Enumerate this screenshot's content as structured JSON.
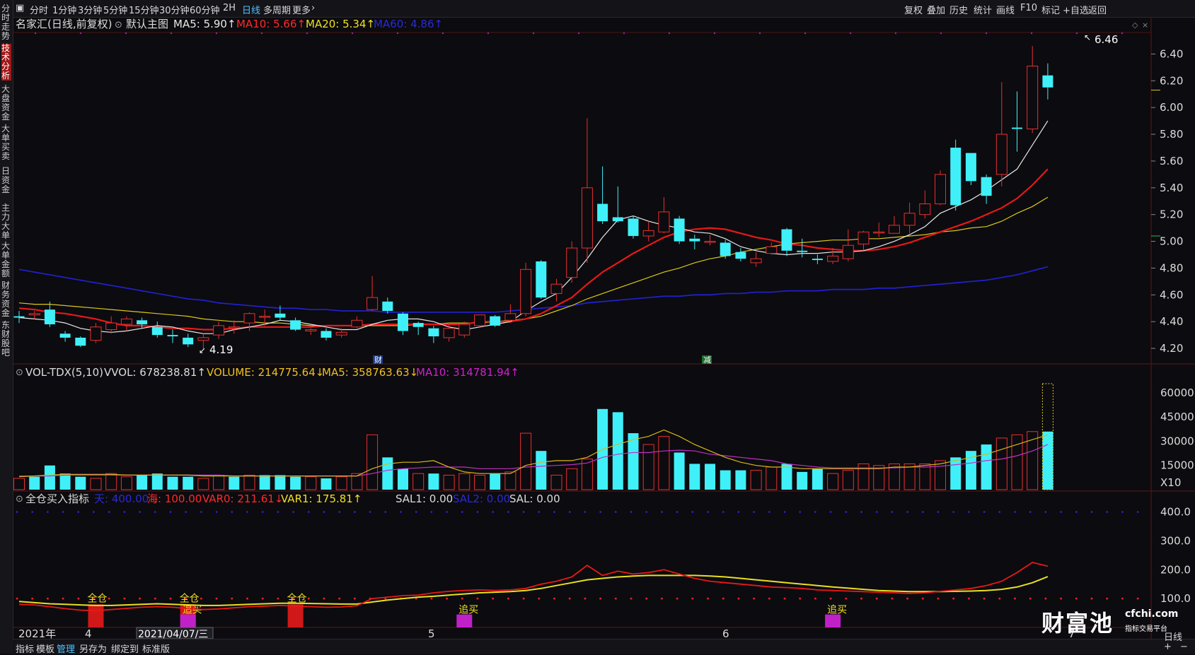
{
  "toolbar": {
    "items": [
      "分时",
      "1分钟",
      "3分钟",
      "5分钟",
      "15分钟",
      "30分钟",
      "60分钟",
      "2H",
      "日线",
      "多周期",
      "更多"
    ],
    "active_index": 8,
    "right_items": [
      "复权",
      "叠加",
      "历史",
      "统计",
      "画线",
      "F10",
      "标记",
      "+自选",
      "返回"
    ]
  },
  "sidebar": {
    "items": [
      "分时走势",
      "技术分析",
      "大盘资金",
      "大单买卖",
      "日资金",
      "主力大单",
      "大单金额",
      "财务资金",
      "东财股吧"
    ],
    "active_index": 1
  },
  "main_panel": {
    "title": "名家汇(日线,前复权)",
    "indicator": "默认主图",
    "ma5": "MA5: 5.90↑",
    "ma10": "MA10: 5.66↑",
    "ma20": "MA20: 5.34↑",
    "ma60": "MA60: 4.86↑",
    "high_label": "6.46",
    "low_label": "4.19",
    "marker_cai": "财",
    "marker_jian": "减",
    "y_ticks": [
      "6.40",
      "6.20",
      "6.00",
      "5.80",
      "5.60",
      "5.40",
      "5.20",
      "5.00",
      "4.80",
      "4.60",
      "4.40",
      "4.20"
    ]
  },
  "volume_panel": {
    "title": "VOL-TDX(5,10)",
    "vvol": "VVOL: 678238.81↑",
    "volume": "VOLUME: 214775.64↓",
    "ma5": "MA5: 358763.63↓",
    "ma10": "MA10: 314781.94↑",
    "y_ticks": [
      "60000",
      "45000",
      "30000",
      "15000",
      "X10"
    ]
  },
  "ind_panel": {
    "title": "全仓买入指标",
    "tian": "天: 400.00",
    "hai": "海: 100.00",
    "var0": "VAR0: 211.61↓",
    "var1": "VAR1: 175.81↑",
    "sal1": "SAL1: 0.00",
    "sal2": "SAL2: 0.00",
    "sal": "SAL: 0.00",
    "y_ticks": [
      "400.0",
      "300.0",
      "200.0",
      "100.0"
    ],
    "signals": [
      {
        "text": "全仓",
        "kind": "full"
      },
      {
        "text": "全仓",
        "kind": "full"
      },
      {
        "text": "追买",
        "kind": "chase"
      },
      {
        "text": "全仓",
        "kind": "full"
      },
      {
        "text": "追买",
        "kind": "chase"
      },
      {
        "text": "追买",
        "kind": "chase"
      }
    ]
  },
  "x_axis": {
    "labels": [
      "2021年",
      "4",
      "2021/04/07/三",
      "5",
      "6",
      "7"
    ]
  },
  "footer": {
    "items": [
      "指标",
      "模板",
      "管理",
      "另存为",
      "绑定到",
      "标准版"
    ],
    "active_index": 2,
    "right": "日线"
  },
  "watermark": {
    "logo": "财富池",
    "site": "cfchi.com",
    "sub": "指标交易平台"
  },
  "chart_data": {
    "type": "candlestick",
    "price_axis": [
      4.1,
      6.55
    ],
    "candles": [
      [
        4.44,
        4.43,
        4.48,
        4.39
      ],
      [
        4.45,
        4.46,
        4.48,
        4.42
      ],
      [
        4.49,
        4.38,
        4.55,
        4.36
      ],
      [
        4.31,
        4.28,
        4.33,
        4.25
      ],
      [
        4.28,
        4.22,
        4.29,
        4.21
      ],
      [
        4.26,
        4.36,
        4.39,
        4.24
      ],
      [
        4.34,
        4.39,
        4.44,
        4.31
      ],
      [
        4.38,
        4.42,
        4.44,
        4.33
      ],
      [
        4.41,
        4.38,
        4.43,
        4.35
      ],
      [
        4.36,
        4.3,
        4.4,
        4.28
      ],
      [
        4.3,
        4.29,
        4.34,
        4.24
      ],
      [
        4.28,
        4.23,
        4.31,
        4.21
      ],
      [
        4.26,
        4.28,
        4.31,
        4.19
      ],
      [
        4.3,
        4.37,
        4.4,
        4.27
      ],
      [
        4.36,
        4.36,
        4.41,
        4.31
      ],
      [
        4.39,
        4.46,
        4.47,
        4.33
      ],
      [
        4.44,
        4.44,
        4.49,
        4.37
      ],
      [
        4.46,
        4.43,
        4.52,
        4.41
      ],
      [
        4.41,
        4.34,
        4.43,
        4.33
      ],
      [
        4.33,
        4.34,
        4.35,
        4.3
      ],
      [
        4.33,
        4.28,
        4.35,
        4.26
      ],
      [
        4.3,
        4.32,
        4.35,
        4.28
      ],
      [
        4.36,
        4.41,
        4.44,
        4.35
      ],
      [
        4.49,
        4.58,
        4.74,
        4.48
      ],
      [
        4.55,
        4.48,
        4.58,
        4.46
      ],
      [
        4.46,
        4.33,
        4.47,
        4.3
      ],
      [
        4.39,
        4.36,
        4.4,
        4.3
      ],
      [
        4.35,
        4.29,
        4.37,
        4.24
      ],
      [
        4.28,
        4.35,
        4.39,
        4.25
      ],
      [
        4.3,
        4.38,
        4.4,
        4.28
      ],
      [
        4.37,
        4.45,
        4.45,
        4.36
      ],
      [
        4.44,
        4.37,
        4.45,
        4.36
      ],
      [
        4.41,
        4.46,
        4.53,
        4.39
      ],
      [
        4.46,
        4.79,
        4.84,
        4.44
      ],
      [
        4.85,
        4.58,
        4.86,
        4.57
      ],
      [
        4.61,
        4.68,
        4.72,
        4.55
      ],
      [
        4.73,
        4.95,
        5.0,
        4.69
      ],
      [
        4.95,
        5.4,
        5.92,
        4.84
      ],
      [
        5.28,
        5.15,
        5.56,
        5.13
      ],
      [
        5.18,
        5.15,
        5.41,
        5.14
      ],
      [
        5.17,
        5.04,
        5.19,
        5.02
      ],
      [
        5.04,
        5.08,
        5.15,
        5.0
      ],
      [
        5.07,
        5.22,
        5.33,
        5.06
      ],
      [
        5.17,
        5.0,
        5.19,
        4.98
      ],
      [
        5.02,
        5.0,
        5.05,
        4.94
      ],
      [
        5.0,
        5.0,
        5.05,
        4.97
      ],
      [
        4.99,
        4.89,
        5.01,
        4.87
      ],
      [
        4.92,
        4.87,
        4.95,
        4.85
      ],
      [
        4.84,
        4.87,
        4.92,
        4.81
      ],
      [
        4.91,
        4.96,
        4.99,
        4.9
      ],
      [
        5.09,
        4.93,
        5.1,
        4.89
      ],
      [
        4.93,
        4.92,
        5.02,
        4.88
      ],
      [
        4.87,
        4.86,
        4.9,
        4.83
      ],
      [
        4.85,
        4.89,
        4.95,
        4.83
      ],
      [
        4.87,
        4.97,
        5.09,
        4.85
      ],
      [
        4.98,
        5.07,
        5.08,
        4.93
      ],
      [
        5.07,
        5.07,
        5.14,
        5.03
      ],
      [
        5.06,
        5.12,
        5.19,
        5.06
      ],
      [
        5.12,
        5.21,
        5.29,
        5.06
      ],
      [
        5.2,
        5.28,
        5.38,
        5.17
      ],
      [
        5.28,
        5.5,
        5.53,
        5.27
      ],
      [
        5.7,
        5.27,
        5.76,
        5.23
      ],
      [
        5.66,
        5.45,
        5.66,
        5.42
      ],
      [
        5.48,
        5.34,
        5.5,
        5.28
      ],
      [
        5.5,
        5.8,
        6.19,
        5.41
      ],
      [
        5.85,
        5.84,
        6.12,
        5.67
      ],
      [
        5.84,
        6.31,
        6.46,
        5.81
      ],
      [
        6.24,
        6.15,
        6.33,
        6.06
      ]
    ],
    "ma5": [
      4.43,
      4.42,
      4.41,
      4.39,
      4.35,
      4.33,
      4.32,
      4.33,
      4.35,
      4.37,
      4.36,
      4.33,
      4.31,
      4.31,
      4.34,
      4.36,
      4.38,
      4.41,
      4.4,
      4.38,
      4.36,
      4.34,
      4.34,
      4.38,
      4.41,
      4.42,
      4.42,
      4.4,
      4.36,
      4.34,
      4.36,
      4.38,
      4.4,
      4.48,
      4.55,
      4.61,
      4.73,
      4.87,
      5.03,
      5.16,
      5.19,
      5.15,
      5.12,
      5.1,
      5.07,
      5.06,
      5.02,
      4.96,
      4.93,
      4.91,
      4.9,
      4.91,
      4.91,
      4.92,
      4.92,
      4.93,
      4.96,
      5.0,
      5.05,
      5.11,
      5.21,
      5.26,
      5.31,
      5.38,
      5.46,
      5.54,
      5.72,
      5.9
    ],
    "ma10": [
      4.5,
      4.49,
      4.47,
      4.46,
      4.44,
      4.42,
      4.39,
      4.37,
      4.37,
      4.36,
      4.35,
      4.35,
      4.34,
      4.34,
      4.35,
      4.36,
      4.36,
      4.36,
      4.36,
      4.36,
      4.37,
      4.37,
      4.37,
      4.38,
      4.38,
      4.38,
      4.38,
      4.38,
      4.38,
      4.38,
      4.4,
      4.4,
      4.4,
      4.42,
      4.46,
      4.52,
      4.58,
      4.68,
      4.77,
      4.84,
      4.91,
      4.97,
      5.03,
      5.07,
      5.09,
      5.1,
      5.09,
      5.06,
      5.03,
      5.01,
      4.98,
      4.97,
      4.95,
      4.94,
      4.93,
      4.93,
      4.94,
      4.96,
      4.99,
      5.03,
      5.07,
      5.11,
      5.15,
      5.2,
      5.25,
      5.32,
      5.42,
      5.54
    ],
    "ma20": [
      4.54,
      4.53,
      4.53,
      4.52,
      4.51,
      4.5,
      4.49,
      4.48,
      4.47,
      4.46,
      4.45,
      4.44,
      4.42,
      4.41,
      4.4,
      4.4,
      4.39,
      4.39,
      4.38,
      4.37,
      4.37,
      4.37,
      4.37,
      4.37,
      4.37,
      4.37,
      4.38,
      4.38,
      4.39,
      4.39,
      4.39,
      4.4,
      4.41,
      4.42,
      4.44,
      4.48,
      4.52,
      4.57,
      4.61,
      4.65,
      4.69,
      4.73,
      4.77,
      4.8,
      4.84,
      4.87,
      4.89,
      4.92,
      4.94,
      4.96,
      4.98,
      4.99,
      5.0,
      5.01,
      5.01,
      5.02,
      5.02,
      5.03,
      5.04,
      5.05,
      5.07,
      5.08,
      5.1,
      5.11,
      5.15,
      5.21,
      5.26,
      5.33
    ],
    "ma60": [
      4.79,
      4.77,
      4.75,
      4.73,
      4.71,
      4.69,
      4.67,
      4.65,
      4.63,
      4.61,
      4.59,
      4.57,
      4.56,
      4.54,
      4.53,
      4.52,
      4.51,
      4.5,
      4.5,
      4.49,
      4.49,
      4.48,
      4.48,
      4.48,
      4.47,
      4.47,
      4.47,
      4.47,
      4.47,
      4.47,
      4.47,
      4.47,
      4.48,
      4.49,
      4.5,
      4.51,
      4.52,
      4.54,
      4.55,
      4.56,
      4.57,
      4.58,
      4.59,
      4.59,
      4.6,
      4.6,
      4.61,
      4.61,
      4.62,
      4.62,
      4.63,
      4.63,
      4.63,
      4.64,
      4.64,
      4.64,
      4.65,
      4.65,
      4.66,
      4.67,
      4.68,
      4.69,
      4.7,
      4.71,
      4.73,
      4.75,
      4.78,
      4.81
    ],
    "vol_axis": [
      0,
      67000
    ],
    "volumes": [
      7000,
      8000,
      15000,
      10000,
      8000,
      7000,
      10000,
      8000,
      9000,
      10000,
      8000,
      8000,
      7000,
      9000,
      8000,
      9000,
      9000,
      9000,
      8000,
      8000,
      7000,
      8000,
      10000,
      34000,
      20000,
      13000,
      10000,
      10000,
      9000,
      10000,
      9000,
      10000,
      11000,
      35000,
      24000,
      9000,
      13000,
      19000,
      50000,
      48000,
      35000,
      28000,
      33000,
      23000,
      16000,
      16000,
      12000,
      12000,
      12000,
      14000,
      16000,
      11000,
      13000,
      10000,
      12000,
      16000,
      15000,
      16000,
      16000,
      16000,
      18000,
      20000,
      24000,
      28000,
      32000,
      34000,
      36000,
      36000
    ],
    "vol_up": [
      1,
      0,
      0,
      0,
      0,
      1,
      1,
      1,
      0,
      0,
      0,
      0,
      1,
      1,
      0,
      1,
      0,
      0,
      0,
      1,
      0,
      1,
      1,
      1,
      0,
      0,
      1,
      0,
      1,
      1,
      1,
      0,
      1,
      1,
      0,
      1,
      1,
      1,
      0,
      0,
      0,
      1,
      1,
      0,
      0,
      0,
      0,
      0,
      1,
      1,
      0,
      0,
      0,
      1,
      1,
      1,
      1,
      1,
      1,
      1,
      1,
      0,
      0,
      0,
      1,
      1,
      1,
      0
    ],
    "vol_ma5": [
      8000,
      8500,
      9000,
      9500,
      9500,
      9500,
      9500,
      9000,
      9000,
      9000,
      9000,
      9000,
      8500,
      8500,
      8500,
      8500,
      8500,
      8500,
      8500,
      8500,
      8500,
      8500,
      8500,
      13000,
      16000,
      17000,
      17000,
      18000,
      14000,
      11000,
      10000,
      10000,
      10000,
      15000,
      17000,
      18000,
      18000,
      20000,
      25000,
      28000,
      31000,
      33000,
      37000,
      33000,
      28000,
      24000,
      20000,
      17000,
      15000,
      14000,
      14000,
      13000,
      13000,
      13000,
      13000,
      13000,
      13000,
      14000,
      14000,
      15000,
      16000,
      18000,
      20000,
      22000,
      25000,
      28000,
      31000,
      34000
    ],
    "vol_ma10": [
      8500,
      8500,
      8500,
      9000,
      9000,
      9000,
      9000,
      9000,
      9000,
      9000,
      9000,
      9000,
      9000,
      9000,
      8500,
      8500,
      8500,
      8500,
      8500,
      8500,
      8500,
      8500,
      8500,
      10000,
      12000,
      13000,
      13500,
      14000,
      14000,
      14000,
      13000,
      13000,
      13000,
      14000,
      14500,
      15000,
      15500,
      16500,
      20000,
      22000,
      23000,
      23000,
      24000,
      24500,
      24000,
      22000,
      21000,
      20000,
      19000,
      18000,
      16000,
      15000,
      14000,
      13500,
      13500,
      13500,
      13500,
      13500,
      14000,
      14000,
      14500,
      15500,
      16500,
      18000,
      19000,
      21000,
      24000,
      28000
    ],
    "ind_axis": [
      0,
      460
    ],
    "var0": [
      80,
      78,
      72,
      65,
      60,
      58,
      62,
      66,
      70,
      72,
      70,
      65,
      62,
      64,
      68,
      72,
      74,
      76,
      74,
      72,
      70,
      71,
      75,
      100,
      105,
      110,
      112,
      120,
      125,
      128,
      130,
      128,
      130,
      135,
      150,
      160,
      175,
      215,
      180,
      195,
      185,
      190,
      200,
      185,
      170,
      160,
      155,
      150,
      145,
      140,
      138,
      135,
      130,
      128,
      126,
      124,
      122,
      120,
      118,
      120,
      125,
      130,
      135,
      145,
      160,
      190,
      225,
      212
    ],
    "var1": [
      90,
      86,
      82,
      80,
      78,
      76,
      76,
      78,
      80,
      82,
      80,
      78,
      76,
      76,
      78,
      80,
      82,
      84,
      84,
      83,
      82,
      81,
      81,
      88,
      95,
      100,
      105,
      108,
      112,
      116,
      120,
      122,
      124,
      128,
      135,
      145,
      155,
      165,
      170,
      175,
      178,
      180,
      180,
      180,
      180,
      178,
      175,
      170,
      165,
      160,
      155,
      150,
      145,
      140,
      136,
      132,
      128,
      126,
      124,
      124,
      124,
      125,
      126,
      128,
      132,
      140,
      155,
      176
    ]
  }
}
